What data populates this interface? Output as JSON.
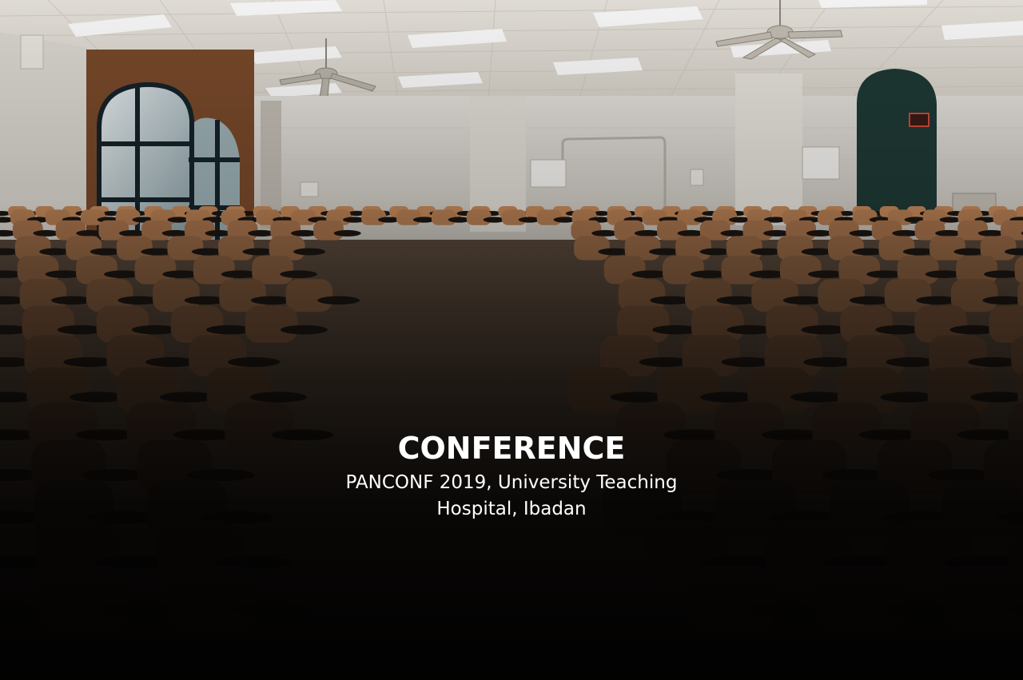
{
  "caption": {
    "title": "CONFERENCE",
    "subtitle": "PANCONF 2019, University Teaching Hospital, Ibadan"
  },
  "colors": {
    "wall": "#e9e6e0",
    "ceiling": "#efece6",
    "seat_wood": "#b77a4e",
    "seat_dark": "#2a1f18",
    "window_frame": "#1d2b33",
    "door": "#23403a",
    "light_panel": "#ffffff",
    "text": "#ffffff"
  }
}
